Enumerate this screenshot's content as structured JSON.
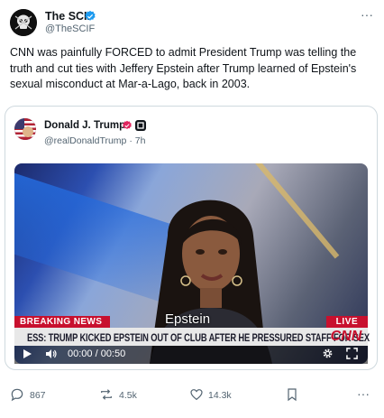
{
  "post": {
    "author_name": "The SCIF",
    "author_handle": "@TheSCIF",
    "more_label": "···",
    "text": "CNN was painfully FORCED to admit President Trump was telling the truth and cut ties with Jeffery Epstein after Trump learned of Epstein's sexual misconduct at Mar-a-Lago, back in 2003."
  },
  "quoted": {
    "author_name": "Donald J. Trump",
    "author_handle": "@realDonaldTrump",
    "time_ago": "· 7h"
  },
  "video": {
    "banner_left": "BREAKING NEWS",
    "banner_right": "LIVE",
    "caption": "Epstein",
    "ticker": "ESS: TRUMP KICKED EPSTEIN OUT OF CLUB AFTER HE PRESSURED STAFF FOR SEX",
    "network_logo": "CNN",
    "time": "00:00 / 00:50"
  },
  "actions": {
    "replies": "867",
    "reposts": "4.5k",
    "likes": "14.3k",
    "more_label": "···"
  },
  "colors": {
    "verified_blue": "#1d9bf0",
    "breaking_red": "#c8102e",
    "gray_text": "#536471"
  }
}
